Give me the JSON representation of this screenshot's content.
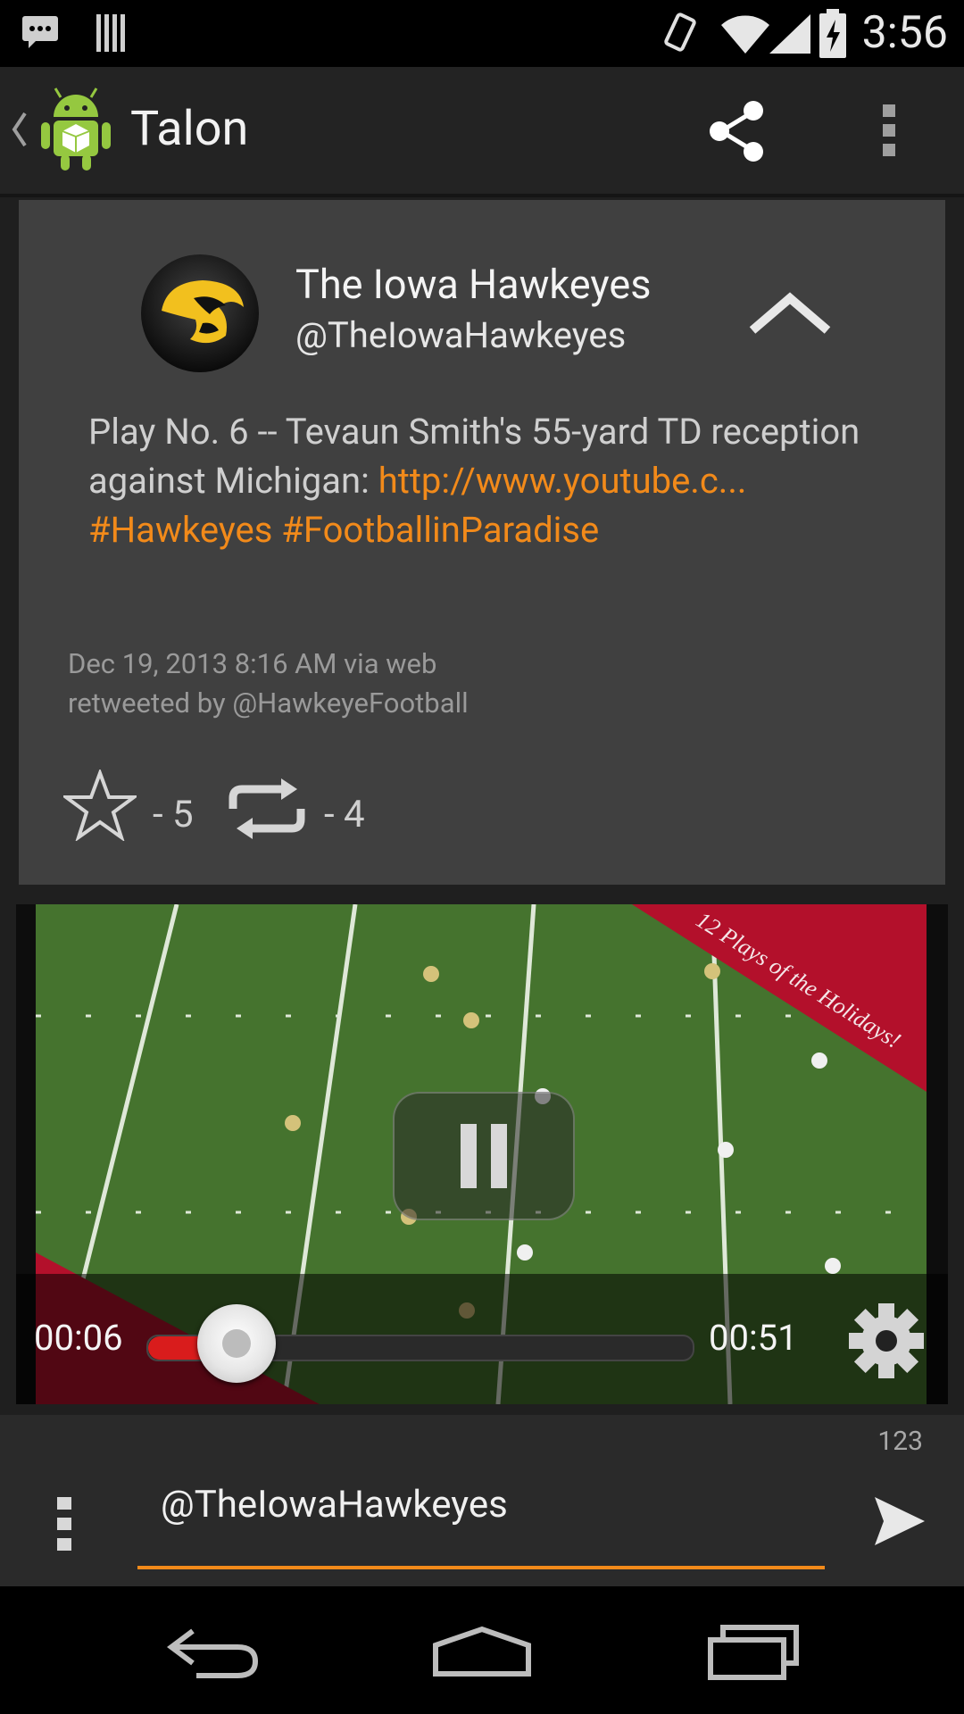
{
  "status_bar": {
    "time": "3:56",
    "left_icons": [
      "talk-icon",
      "barcode-icon"
    ],
    "right_icons": [
      "rotate-icon",
      "wifi-icon",
      "signal-icon",
      "battery-icon"
    ]
  },
  "action_bar": {
    "title": "Talon",
    "icons": [
      "back-chevron-icon",
      "android-app-icon",
      "share-icon",
      "overflow-icon"
    ]
  },
  "tweet": {
    "name": "The Iowa Hawkeyes",
    "handle": "@TheIowaHawkeyes",
    "text_plain": "Play No. 6 -- Tevaun Smith's 55-yard TD reception against Michigan: ",
    "link_text": "http://www.youtube.c...",
    "hashtag_1": "#Hawkeyes",
    "hashtag_2": "#FootballinParadise",
    "date_line": "Dec 19, 2013 8:16 AM via web",
    "retweet_line": "retweeted by @HawkeyeFootball",
    "favorites": "- 5",
    "retweets": "- 4",
    "colors": {
      "accent": "#f28a1a",
      "card_bg": "#404040"
    }
  },
  "video": {
    "banner_text": "12 Plays of the Holidays!",
    "current_time": "00:06",
    "duration": "00:51",
    "progress": 0.13
  },
  "compose": {
    "char_count": "123",
    "input_value": "@TheIowaHawkeyes"
  },
  "nav_bar": {
    "icons": [
      "back-icon",
      "home-icon",
      "recents-icon"
    ]
  }
}
